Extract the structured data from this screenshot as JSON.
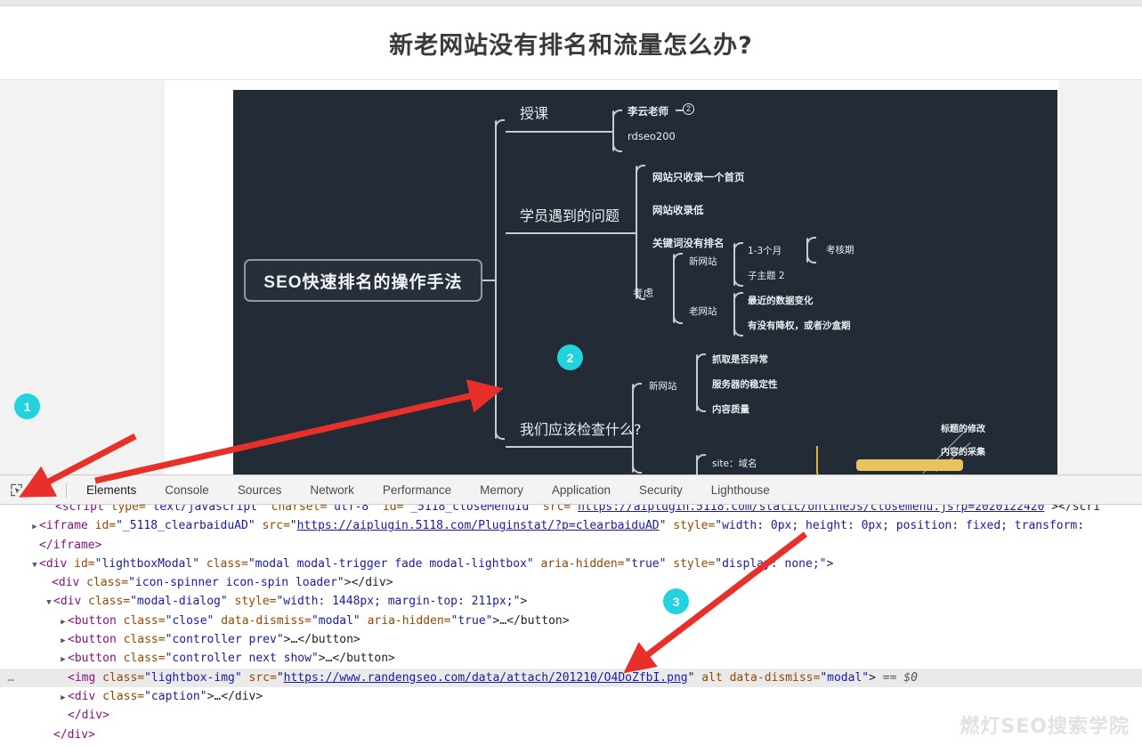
{
  "article": {
    "title": "新老网站没有排名和流量怎么办?"
  },
  "mindmap": {
    "central": "SEO快速排名的操作手法",
    "branch_teaching": {
      "label": "授课",
      "items": [
        "李云老师",
        "rdseo200"
      ],
      "badge": "2"
    },
    "branch_problems": {
      "label": "学员遇到的问题",
      "items": [
        "网站只收录一个首页",
        "网站收录低",
        "关键词没有排名"
      ]
    },
    "branch_consider": {
      "label": "考虑",
      "new_site": {
        "label": "新网站",
        "items": [
          "1-3个月",
          "子主题 2"
        ],
        "sub": "考核期"
      },
      "old_site": {
        "label": "老网站",
        "items": [
          "最近的数据变化",
          "有没有降权，或者沙盒期"
        ]
      }
    },
    "branch_check": {
      "label": "我们应该检查什么?",
      "new_site": {
        "label": "新网站",
        "items": [
          "抓取是否异常",
          "服务器的稳定性",
          "内容质量"
        ]
      },
      "site_cmd": "site：域名",
      "right_items": [
        "标题的修改",
        "内容的采集"
      ]
    }
  },
  "devtools": {
    "inspect_icon": "inspect-element-icon",
    "device_icon": "device-toolbar-icon",
    "tabs": [
      {
        "label": "Elements",
        "active": true
      },
      {
        "label": "Console",
        "active": false
      },
      {
        "label": "Sources",
        "active": false
      },
      {
        "label": "Network",
        "active": false
      },
      {
        "label": "Performance",
        "active": false
      },
      {
        "label": "Memory",
        "active": false
      },
      {
        "label": "Application",
        "active": false
      },
      {
        "label": "Security",
        "active": false
      },
      {
        "label": "Lighthouse",
        "active": false
      }
    ],
    "dom": {
      "line1": {
        "tag_open": "<script",
        "attr1": " type=",
        "val1": "\"text/javascript\"",
        "attr2": " charset=",
        "val2": "\"utf-8\"",
        "attr3": " id=",
        "val3": "\"_5118_closeMenuId\"",
        "attr4": " src=",
        "url": "https://aiplugin.5118.com/static/onlineJs/closemenu.js?p=2020122420",
        "tail": "></scri"
      },
      "line2": {
        "tag_open": "<iframe",
        "attr1": " id=",
        "val1": "\"_5118_clearbaiduAD\"",
        "attr2": " src=",
        "url": "https://aiplugin.5118.com/Pluginstat/?p=clearbaiduAD",
        "attr3": " style=",
        "val3": "\"width: 0px; height: 0px; position: fixed; transform:",
        "tail": ""
      },
      "line3": "</iframe>",
      "line4": {
        "tag_open": "<div",
        "attr1": " id=",
        "val1": "\"lightboxModal\"",
        "attr2": " class=",
        "val2": "\"modal modal-trigger fade modal-lightbox\"",
        "attr3": " aria-hidden=",
        "val3": "\"true\"",
        "attr4": " style=",
        "val4": "\"display: none;\"",
        "tail": ">"
      },
      "line5": {
        "tag_open": "<div",
        "attr1": " class=",
        "val1": "\"icon-spinner icon-spin loader\"",
        "tail": "></div>"
      },
      "line6": {
        "tag_open": "<div",
        "attr1": " class=",
        "val1": "\"modal-dialog\"",
        "attr2": " style=",
        "val2": "\"width: 1448px; margin-top: 211px;\"",
        "tail": ">"
      },
      "line7": {
        "tag_open": "<button",
        "attr1": " class=",
        "val1": "\"close\"",
        "attr2": " data-dismiss=",
        "val2": "\"modal\"",
        "attr3": " aria-hidden=",
        "val3": "\"true\"",
        "tail": ">…</button>"
      },
      "line8": {
        "tag_open": "<button",
        "attr1": " class=",
        "val1": "\"controller prev\"",
        "tail": ">…</button>"
      },
      "line9": {
        "tag_open": "<button",
        "attr1": " class=",
        "val1": "\"controller next show\"",
        "tail": ">…</button>"
      },
      "line10": {
        "gutter": "…",
        "tag_open": "<img",
        "attr1": " class=",
        "val1": "\"lightbox-img\"",
        "attr2": " src=",
        "url": "https://www.randengseo.com/data/attach/201210/O4DoZfbI.png",
        "attr3": " alt",
        "attr4": " data-dismiss=",
        "val4": "\"modal\"",
        "tail": ">",
        "selected_marker": "== $0"
      },
      "line11": {
        "tag_open": "<div",
        "attr1": " class=",
        "val1": "\"caption\"",
        "tail": ">…</div>"
      },
      "line12": "</div>",
      "line13": "</div>"
    }
  },
  "annotations": {
    "badge1": "1",
    "badge2": "2",
    "badge3": "3"
  },
  "watermark": "燃灯SEO搜索学院",
  "colors": {
    "badge": "#22d3dd",
    "arrow": "#e8302a",
    "mindmap_bg": "#222b36",
    "devtools_toolbar": "#f3f3f3"
  }
}
